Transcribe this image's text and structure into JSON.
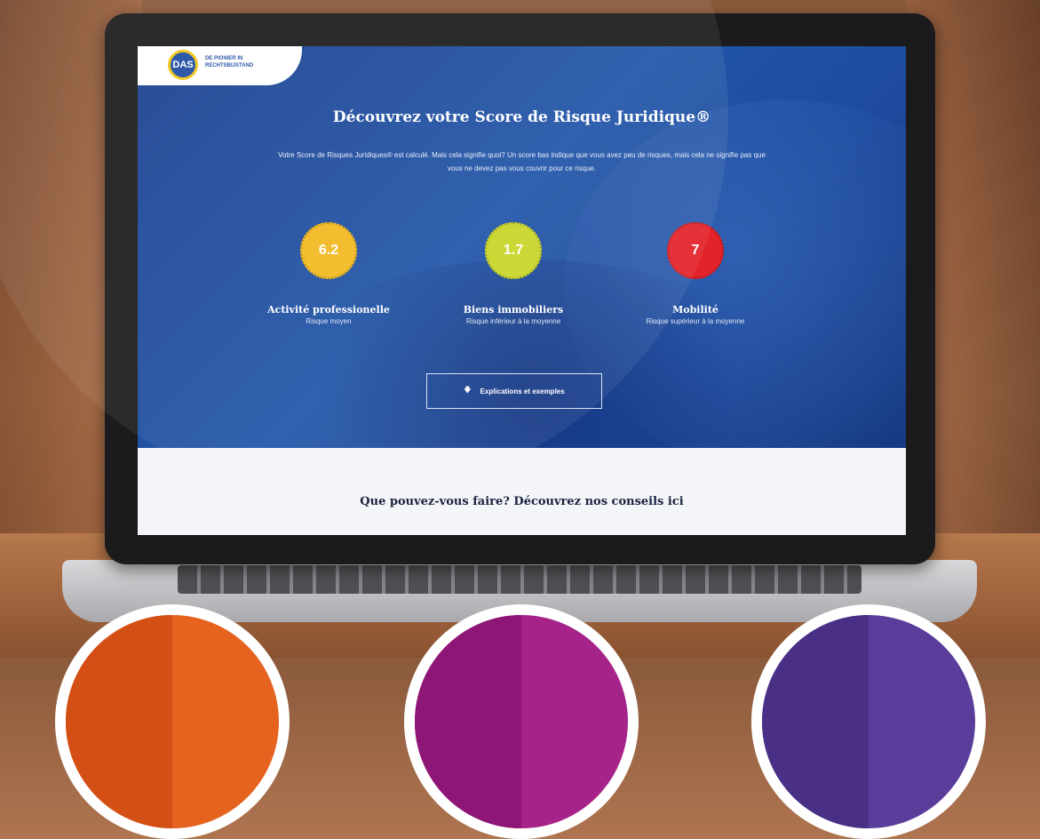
{
  "logo": {
    "mark": "DAS",
    "tagline": "DE PIONIER IN RECHTSBIJSTAND"
  },
  "hero": {
    "title": "Découvrez votre Score de Risque Juridique®",
    "description": "Votre Score de Risques Juridiques® est calculé. Mais cela signifie quoi? Un score bas indique que vous avez peu de risques, mais cela ne signifie pas que vous ne devez pas vous couvrir pour ce risque."
  },
  "scores": [
    {
      "value": "6.2",
      "label": "Activité professionelle",
      "sub": "Risque moyen",
      "color": "#f1b91f"
    },
    {
      "value": "1.7",
      "label": "Biens immobiliers",
      "sub": "Risque inférieur à la moyenne",
      "color": "#c8d627"
    },
    {
      "value": "7",
      "label": "Mobilité",
      "sub": "Risque supérieur à la moyenne",
      "color": "#e3232a"
    }
  ],
  "cta": {
    "label": "Explications et exemples",
    "icon": "arrow-down-icon"
  },
  "advice": {
    "title": "Que pouvez-vous faire? Découvrez nos conseils ici"
  },
  "colors": {
    "hero": "#1f4ea3",
    "accent": "#f3c417"
  }
}
